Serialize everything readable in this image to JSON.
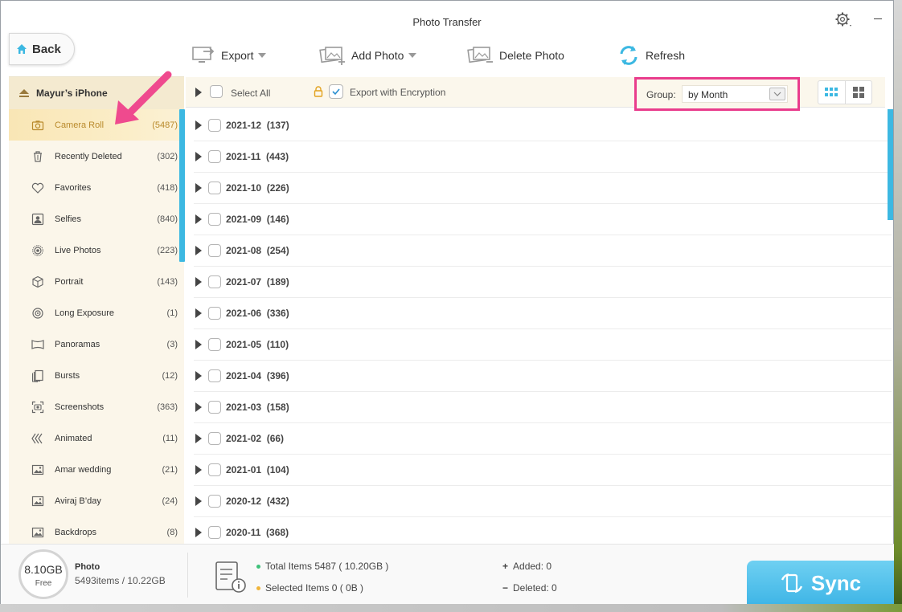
{
  "window": {
    "title": "Photo Transfer"
  },
  "toolbar": {
    "back_label": "Back",
    "export_label": "Export",
    "add_photo_label": "Add Photo",
    "delete_photo_label": "Delete Photo",
    "refresh_label": "Refresh"
  },
  "sidebar": {
    "device_name": "Mayur’s iPhone",
    "items": [
      {
        "label": "Camera Roll",
        "count": "(5487)",
        "icon": "camera-icon",
        "active": true
      },
      {
        "label": "Recently Deleted",
        "count": "(302)",
        "icon": "trash-icon"
      },
      {
        "label": "Favorites",
        "count": "(418)",
        "icon": "heart-icon"
      },
      {
        "label": "Selfies",
        "count": "(840)",
        "icon": "person-icon"
      },
      {
        "label": "Live Photos",
        "count": "(223)",
        "icon": "live-icon"
      },
      {
        "label": "Portrait",
        "count": "(143)",
        "icon": "cube-icon"
      },
      {
        "label": "Long Exposure",
        "count": "(1)",
        "icon": "exposure-icon"
      },
      {
        "label": "Panoramas",
        "count": "(3)",
        "icon": "panorama-icon"
      },
      {
        "label": "Bursts",
        "count": "(12)",
        "icon": "bursts-icon"
      },
      {
        "label": "Screenshots",
        "count": "(363)",
        "icon": "screenshot-icon"
      },
      {
        "label": "Animated",
        "count": "(11)",
        "icon": "animated-icon"
      },
      {
        "label": "Amar wedding",
        "count": "(21)",
        "icon": "album-icon"
      },
      {
        "label": "Aviraj B’day",
        "count": "(24)",
        "icon": "album-icon"
      },
      {
        "label": "Backdrops",
        "count": "(8)",
        "icon": "album-icon"
      }
    ]
  },
  "main": {
    "select_all_label": "Select All",
    "encryption_label": "Export with Encryption",
    "encryption_checked": true,
    "group_label": "Group:",
    "group_value": "by Month",
    "groups": [
      "2021-12  (137)",
      "2021-11  (443)",
      "2021-10  (226)",
      "2021-09  (146)",
      "2021-08  (254)",
      "2021-07  (189)",
      "2021-06  (336)",
      "2021-05  (110)",
      "2021-04  (396)",
      "2021-03  (158)",
      "2021-02  (66)",
      "2021-01  (104)",
      "2020-12  (432)",
      "2020-11  (368)"
    ]
  },
  "footer": {
    "storage_free": "8.10GB",
    "storage_free_label": "Free",
    "category_title": "Photo",
    "category_sub": "5493items / 10.22GB",
    "total_items": "Total Items  5487  ( 10.20GB )",
    "selected_items": "Selected Items  0  ( 0B )",
    "added": "Added: 0",
    "deleted": "Deleted: 0",
    "sync_label": "Sync"
  },
  "colors": {
    "accent": "#3cb8e2",
    "highlight_border": "#e93c8c",
    "active_label": "#b98a2c"
  }
}
